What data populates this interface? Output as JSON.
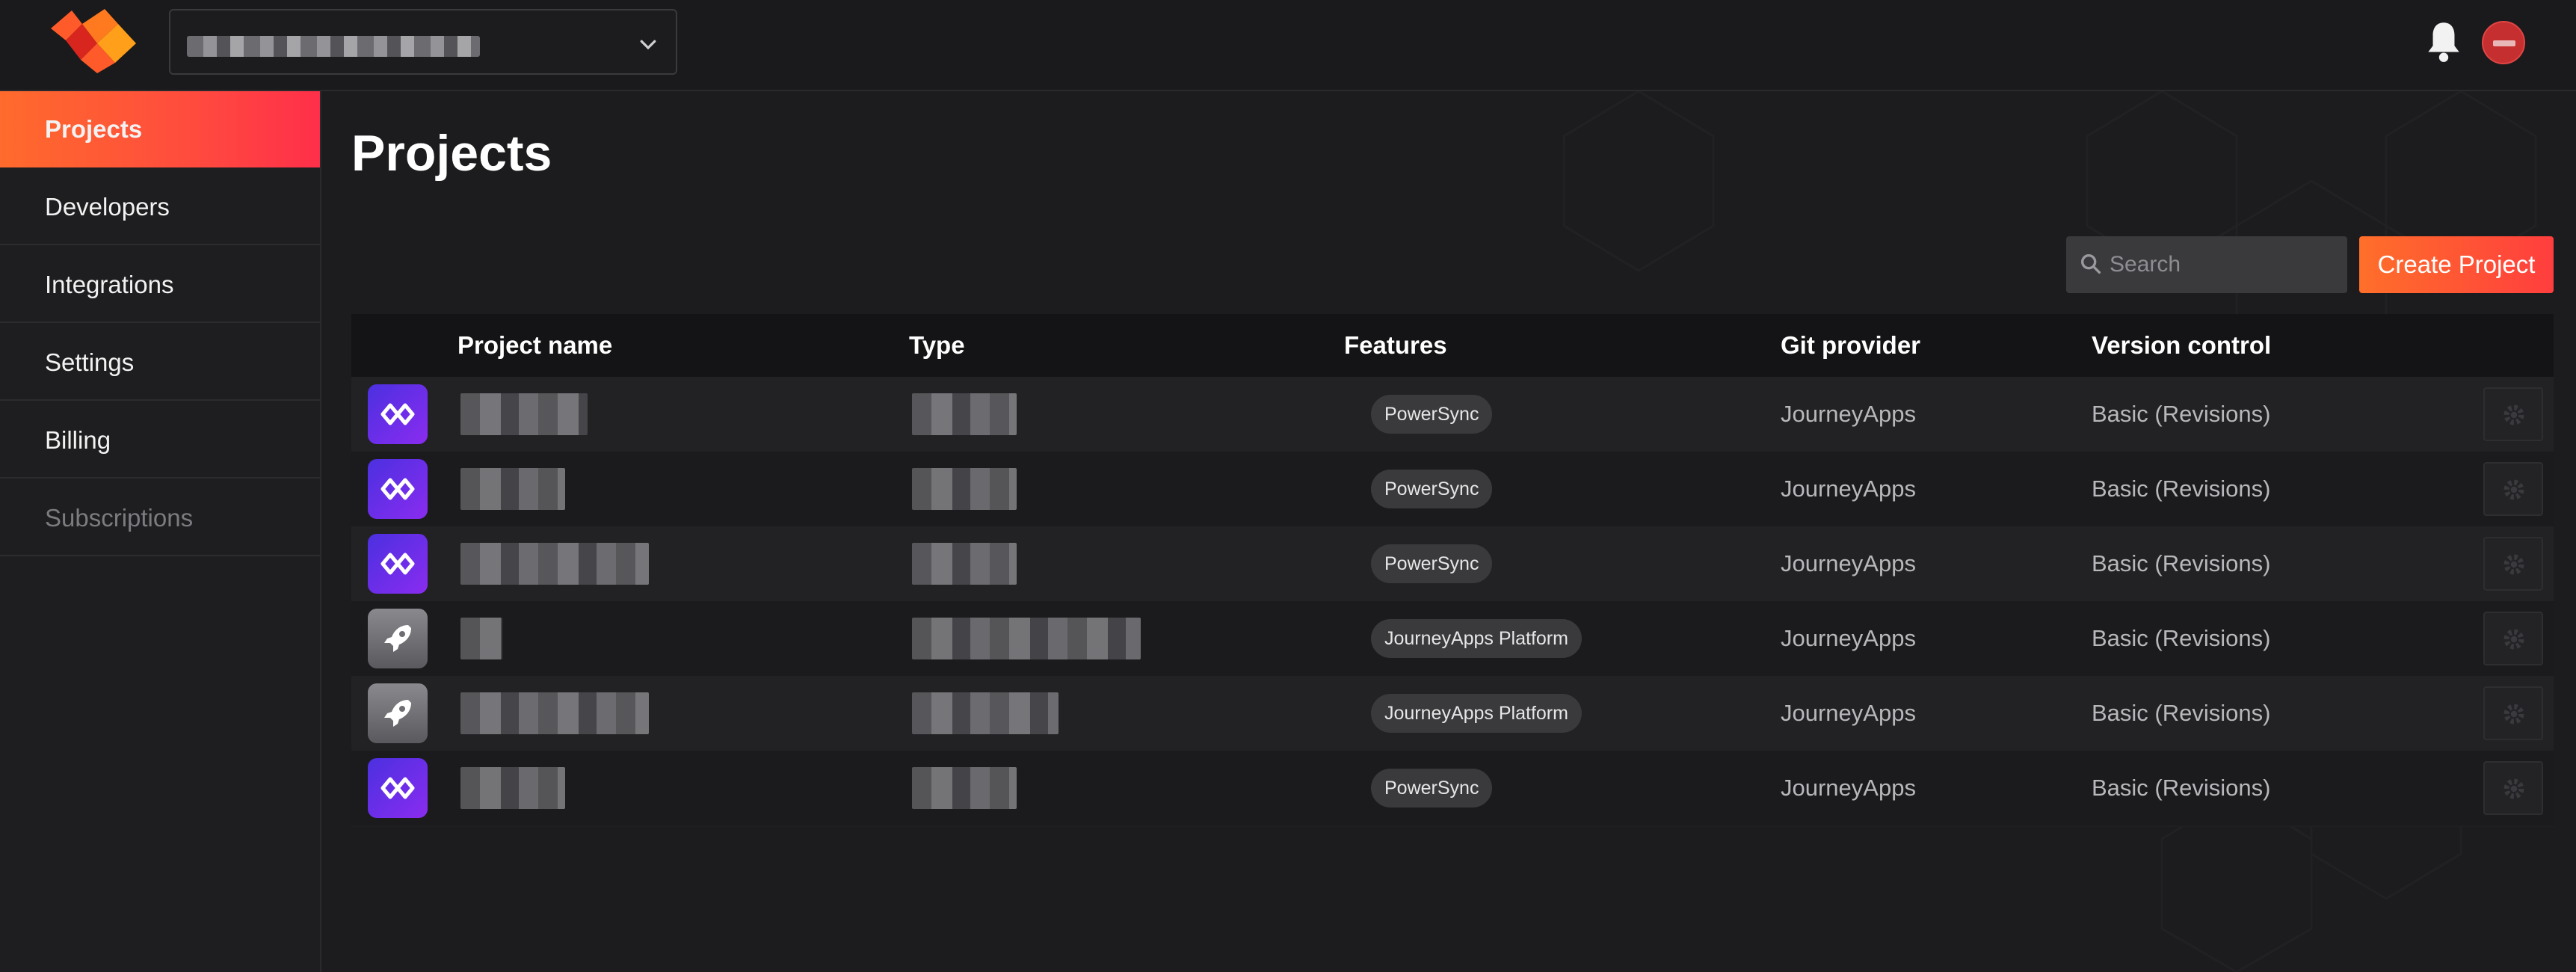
{
  "app": {
    "name": "JourneyApps",
    "colors": {
      "accent_start": "#ff6b2c",
      "accent_end": "#ff2f4a",
      "badge_bg": "#3a3a3d"
    }
  },
  "header": {
    "org_select_icon": "chevron-down-icon",
    "notifications_icon": "bell-icon"
  },
  "sidebar": {
    "items": [
      {
        "label": "Projects",
        "active": true
      },
      {
        "label": "Developers",
        "active": false
      },
      {
        "label": "Integrations",
        "active": false
      },
      {
        "label": "Settings",
        "active": false
      },
      {
        "label": "Billing",
        "active": false
      },
      {
        "label": "Subscriptions",
        "active": false,
        "muted": true
      }
    ]
  },
  "main": {
    "title": "Projects",
    "search": {
      "placeholder": "Search"
    },
    "create_button": "Create Project",
    "table": {
      "columns": [
        "Project name",
        "Type",
        "Features",
        "Git provider",
        "Version control"
      ],
      "rows": [
        {
          "icon": "powersync-icon",
          "feature": "PowerSync",
          "git_provider": "JourneyApps",
          "version_control": "Basic (Revisions)"
        },
        {
          "icon": "powersync-icon",
          "feature": "PowerSync",
          "git_provider": "JourneyApps",
          "version_control": "Basic (Revisions)"
        },
        {
          "icon": "powersync-icon",
          "feature": "PowerSync",
          "git_provider": "JourneyApps",
          "version_control": "Basic (Revisions)"
        },
        {
          "icon": "rocket-icon",
          "feature": "JourneyApps Platform",
          "git_provider": "JourneyApps",
          "version_control": "Basic (Revisions)"
        },
        {
          "icon": "rocket-icon",
          "feature": "JourneyApps Platform",
          "git_provider": "JourneyApps",
          "version_control": "Basic (Revisions)"
        },
        {
          "icon": "powersync-icon",
          "feature": "PowerSync",
          "git_provider": "JourneyApps",
          "version_control": "Basic (Revisions)"
        }
      ]
    }
  }
}
